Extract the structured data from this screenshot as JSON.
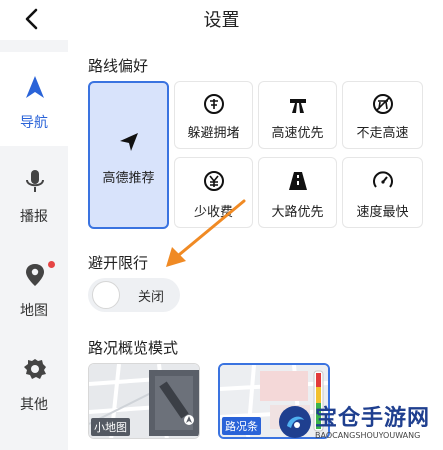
{
  "header": {
    "title": "设置"
  },
  "sidebar": {
    "items": [
      {
        "label": "导航",
        "icon": "navigation-arrow-icon",
        "active": true
      },
      {
        "label": "播报",
        "icon": "microphone-icon"
      },
      {
        "label": "地图",
        "icon": "map-pin-icon",
        "badge": true
      },
      {
        "label": "其他",
        "icon": "gear-icon"
      }
    ]
  },
  "route_pref": {
    "title": "路线偏好",
    "options": [
      {
        "label": "高德推荐",
        "icon": "send-arrow-icon",
        "selected": true
      },
      {
        "label": "躲避拥堵",
        "icon": "avoid-congestion-icon"
      },
      {
        "label": "高速优先",
        "icon": "highway-icon"
      },
      {
        "label": "不走高速",
        "icon": "no-highway-icon"
      },
      {
        "label": "少收费",
        "icon": "less-toll-icon"
      },
      {
        "label": "大路优先",
        "icon": "main-road-icon"
      },
      {
        "label": "速度最快",
        "icon": "speedometer-icon"
      }
    ]
  },
  "avoid_limit": {
    "title": "避开限行",
    "toggle_label": "关闭",
    "enabled": false
  },
  "traffic_mode": {
    "title": "路况概览模式",
    "options": [
      {
        "label": "小地图",
        "selected": false
      },
      {
        "label": "路况条",
        "selected": true
      }
    ]
  },
  "watermark": {
    "text": "宝仓手游网",
    "sub": "BAOCANGSHOUYOUWANG"
  },
  "colors": {
    "accent": "#2a63d8",
    "selected_bg": "#d8e3fb",
    "arrow": "#f08a24"
  }
}
